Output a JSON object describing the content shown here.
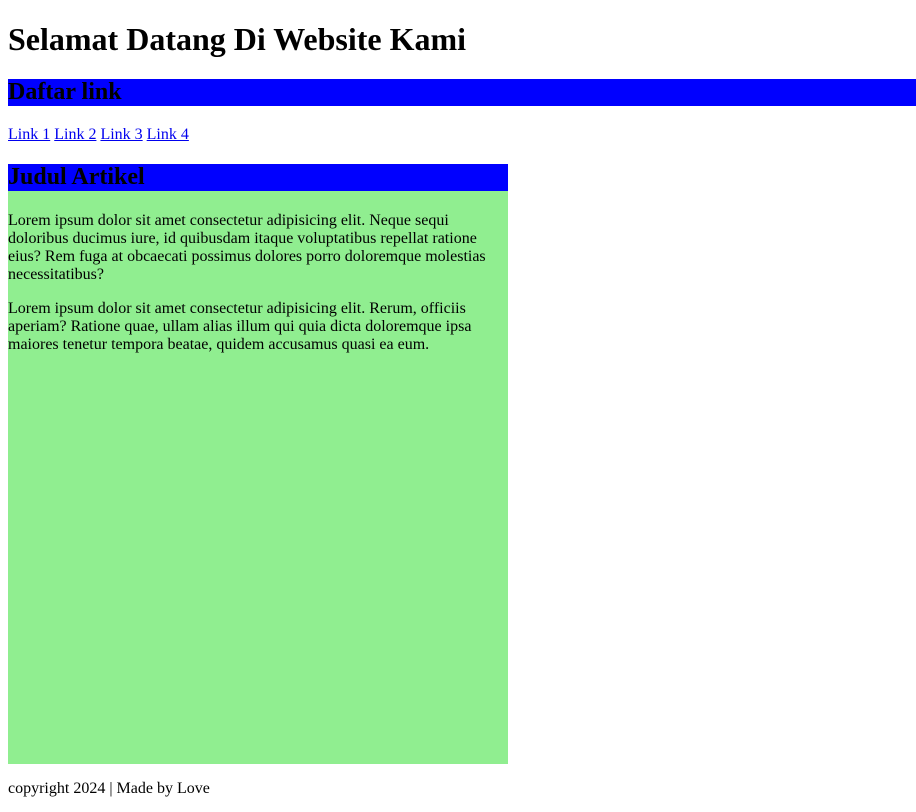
{
  "header": {
    "title": "Selamat Datang Di Website Kami"
  },
  "nav": {
    "heading": "Daftar link",
    "links": [
      "Link 1",
      "Link 2",
      "Link 3",
      "Link 4"
    ]
  },
  "article": {
    "title": "Judul Artikel",
    "paragraphs": [
      "Lorem ipsum dolor sit amet consectetur adipisicing elit. Neque sequi doloribus ducimus iure, id quibusdam itaque voluptatibus repellat ratione eius? Rem fuga at obcaecati possimus dolores porro doloremque molestias necessitatibus?",
      "Lorem ipsum dolor sit amet consectetur adipisicing elit. Rerum, officiis aperiam? Ratione quae, ullam alias illum qui quia dicta doloremque ipsa maiores tenetur tempora beatae, quidem accusamus quasi ea eum."
    ]
  },
  "footer": {
    "text": "copyright 2024 | Made by Love"
  },
  "colors": {
    "header_bar": "#0000ff",
    "article_bg": "#90ee90",
    "link": "#0000ee"
  }
}
